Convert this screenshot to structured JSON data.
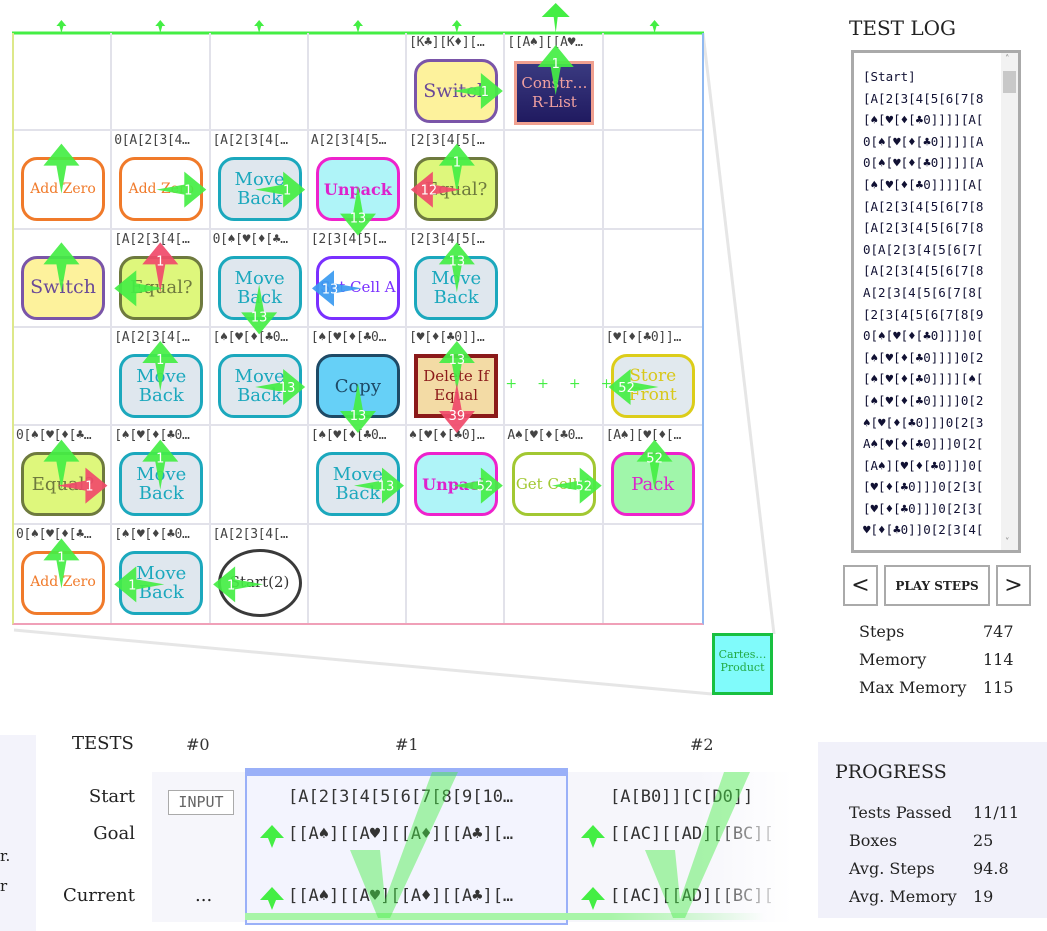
{
  "colors": {
    "green": "#44ee44",
    "red": "#f04a6a",
    "blue": "#3a9af0",
    "rail": "#44ee44"
  },
  "grid": {
    "rows": [
      [
        {},
        {},
        {},
        {},
        {
          "label": "[K♣][K♦][…",
          "box": {
            "type": "switch",
            "text": "Switch"
          },
          "arrows": [
            {
              "dir": "right",
              "n": "1",
              "color": "green"
            }
          ]
        },
        {
          "label": "[[A♠][[A♥…",
          "box": {
            "type": "construct",
            "text": "Constr… R-List"
          },
          "arrows": [
            {
              "dir": "up",
              "n": "1",
              "color": "green"
            }
          ]
        },
        {}
      ],
      [
        {
          "box": {
            "type": "add-zero",
            "text": "Add Zero"
          },
          "arrows": [
            {
              "dir": "up",
              "n": "",
              "color": "green"
            }
          ]
        },
        {
          "label": "0[A[2[3[4…",
          "box": {
            "type": "add-zero",
            "text": "Add Zero"
          },
          "arrows": [
            {
              "dir": "right",
              "n": "1",
              "color": "green"
            }
          ]
        },
        {
          "label": "[A[2[3[4[…",
          "box": {
            "type": "move-back",
            "text": "Move Back"
          },
          "arrows": [
            {
              "dir": "right",
              "n": "1",
              "color": "green"
            }
          ]
        },
        {
          "label": "A[2[3[4[5…",
          "box": {
            "type": "unpack",
            "text": "Unpack"
          },
          "arrows": [
            {
              "dir": "down",
              "n": "13",
              "color": "green"
            }
          ]
        },
        {
          "label": "[2[3[4[5[…",
          "box": {
            "type": "equal",
            "text": "Equal?"
          },
          "arrows": [
            {
              "dir": "up",
              "n": "1",
              "color": "green"
            },
            {
              "dir": "left",
              "n": "12",
              "color": "red"
            }
          ]
        },
        {},
        {}
      ],
      [
        {
          "box": {
            "type": "switch",
            "text": "Switch"
          },
          "arrows": [
            {
              "dir": "up",
              "n": "",
              "color": "green"
            }
          ]
        },
        {
          "label": "[A[2[3[4[…",
          "box": {
            "type": "equal",
            "text": "Equal?"
          },
          "arrows": [
            {
              "dir": "left",
              "n": "",
              "color": "green"
            },
            {
              "dir": "up",
              "n": "1",
              "color": "red"
            }
          ]
        },
        {
          "label": "0[♠[♥[♦[♣…",
          "box": {
            "type": "move-back",
            "text": "Move Back"
          },
          "arrows": [
            {
              "dir": "down",
              "n": "13",
              "color": "green"
            }
          ]
        },
        {
          "label": "[2[3[4[5[…",
          "box": {
            "type": "set-cell",
            "text": "Set Cell A"
          },
          "arrows": [
            {
              "dir": "left",
              "n": "13",
              "color": "blue"
            }
          ]
        },
        {
          "label": "[2[3[4[5[…",
          "box": {
            "type": "move-back",
            "text": "Move Back"
          },
          "arrows": [
            {
              "dir": "up",
              "n": "13",
              "color": "green"
            }
          ]
        },
        {},
        {}
      ],
      [
        {},
        {
          "label": "[A[2[3[4[…",
          "box": {
            "type": "move-back",
            "text": "Move Back"
          },
          "arrows": [
            {
              "dir": "up",
              "n": "1",
              "color": "green"
            }
          ]
        },
        {
          "label": "[♠[♥[♦[♣0…",
          "box": {
            "type": "move-back",
            "text": "Move Back"
          },
          "arrows": [
            {
              "dir": "right",
              "n": "13",
              "color": "green"
            }
          ]
        },
        {
          "label": "[♠[♥[♦[♣0…",
          "box": {
            "type": "copy",
            "text": "Copy"
          },
          "arrows": [
            {
              "dir": "down",
              "n": "13",
              "color": "green"
            }
          ]
        },
        {
          "label": "[♥[♦[♣0]]…",
          "box": {
            "type": "delete-if-equal",
            "text": "Delete If Equal"
          },
          "arrows": [
            {
              "dir": "up",
              "n": "13",
              "color": "green"
            },
            {
              "dir": "down",
              "n": "39",
              "color": "red"
            }
          ]
        },
        {
          "dots": "++++"
        },
        {
          "label": "[♥[♦[♣0]]…",
          "box": {
            "type": "store-front",
            "text": "Store Front"
          },
          "arrows": [
            {
              "dir": "left",
              "n": "52",
              "color": "green"
            }
          ]
        }
      ],
      [
        {
          "label": "0[♠[♥[♦[♣…",
          "box": {
            "type": "equal",
            "text": "Equal?"
          },
          "arrows": [
            {
              "dir": "up",
              "n": "",
              "color": "green"
            },
            {
              "dir": "right",
              "n": "1",
              "color": "red"
            }
          ]
        },
        {
          "label": "[♠[♥[♦[♣0…",
          "box": {
            "type": "move-back",
            "text": "Move Back"
          },
          "arrows": [
            {
              "dir": "up",
              "n": "1",
              "color": "green"
            }
          ]
        },
        {},
        {
          "label": "[♠[♥[♦[♣0…",
          "box": {
            "type": "move-back",
            "text": "Move Back"
          },
          "arrows": [
            {
              "dir": "right",
              "n": "13",
              "color": "green"
            }
          ]
        },
        {
          "label": "♠[♥[♦[♣0]…",
          "box": {
            "type": "unpack",
            "text": "Unpack"
          },
          "arrows": [
            {
              "dir": "right",
              "n": "52",
              "color": "green"
            }
          ]
        },
        {
          "label": "A♠[♥[♦[♣0…",
          "box": {
            "type": "get-cell",
            "text": "Get Cell A"
          },
          "arrows": [
            {
              "dir": "right",
              "n": "52",
              "color": "green"
            }
          ]
        },
        {
          "label": "[A♠][♥[♦[…",
          "box": {
            "type": "pack",
            "text": "Pack"
          },
          "arrows": [
            {
              "dir": "up",
              "n": "52",
              "color": "green"
            }
          ]
        }
      ],
      [
        {
          "label": "0[♠[♥[♦[♣…",
          "box": {
            "type": "add-zero",
            "text": "Add Zero"
          },
          "arrows": [
            {
              "dir": "up",
              "n": "1",
              "color": "green"
            }
          ]
        },
        {
          "label": "[♠[♥[♦[♣0…",
          "box": {
            "type": "move-back",
            "text": "Move Back"
          },
          "arrows": [
            {
              "dir": "left",
              "n": "1",
              "color": "green"
            }
          ]
        },
        {
          "label": "[A[2[3[4[…",
          "box": {
            "type": "start",
            "text": "Start(2)"
          },
          "arrows": [
            {
              "dir": "left",
              "n": "1",
              "color": "green"
            }
          ]
        },
        {},
        {},
        {},
        {}
      ]
    ]
  },
  "minimap": {
    "text": "Cartes… Product"
  },
  "log": {
    "title": "TEST LOG",
    "lines": [
      "[Start]",
      "[A[2[3[4[5[6[7[8",
      "[♠[♥[♦[♣0]]]][A[",
      "0[♠[♥[♦[♣0]]]][A",
      "0[♠[♥[♦[♣0]]]][A",
      "[♠[♥[♦[♣0]]]][A[",
      "[A[2[3[4[5[6[7[8",
      "[A[2[3[4[5[6[7[8",
      "0[A[2[3[4[5[6[7[",
      "[A[2[3[4[5[6[7[8",
      "A[2[3[4[5[6[7[8[",
      "[2[3[4[5[6[7[8[9",
      "0[♠[♥[♦[♣0]]]]0[",
      "[♠[♥[♦[♣0]]]]0[2",
      "[♠[♥[♦[♣0]]]][♠[",
      "[♠[♥[♦[♣0]]]]0[2",
      "♠[♥[♦[♣0]]]0[2[3",
      "A♠[♥[♦[♣0]]]0[2[",
      "[A♠][♥[♦[♣0]]]0[",
      "[♥[♦[♣0]]]0[2[3[",
      "[♥[♦[♣0]]]0[2[3[",
      "♥[♦[♣0]]0[2[3[4["
    ]
  },
  "controls": {
    "prev": "<",
    "play": "PLAY STEPS",
    "next": ">"
  },
  "stats": [
    {
      "label": "Steps",
      "value": "747"
    },
    {
      "label": "Memory",
      "value": "114"
    },
    {
      "label": "Max Memory",
      "value": "115"
    }
  ],
  "tests": {
    "title": "TESTS",
    "columns": [
      "#0",
      "#1",
      "#2"
    ],
    "row_labels": [
      "Start",
      "Goal",
      "Current"
    ],
    "input_button": "INPUT",
    "ellipsis": "...",
    "t1": {
      "start": "[A[2[3[4[5[6[7[8[9[10…",
      "goal": "[[A♠][[A♥][[A♦][[A♣][…",
      "current": "[[A♠][[A♥][[A♦][[A♣][…",
      "passed": true
    },
    "t2": {
      "start": "[A[B0]][C[D0]]",
      "goal": "[[AC][[AD][[BC][",
      "current": "[[AC][[AD][[BC][",
      "passed": true
    }
  },
  "left_fragment": {
    "line1": "r.",
    "line2": "r"
  },
  "progress": {
    "title": "PROGRESS",
    "rows": [
      {
        "label": "Tests Passed",
        "value": "11/11"
      },
      {
        "label": "Boxes",
        "value": "25"
      },
      {
        "label": "Avg. Steps",
        "value": "94.8"
      },
      {
        "label": "Avg. Memory",
        "value": "19"
      }
    ]
  }
}
